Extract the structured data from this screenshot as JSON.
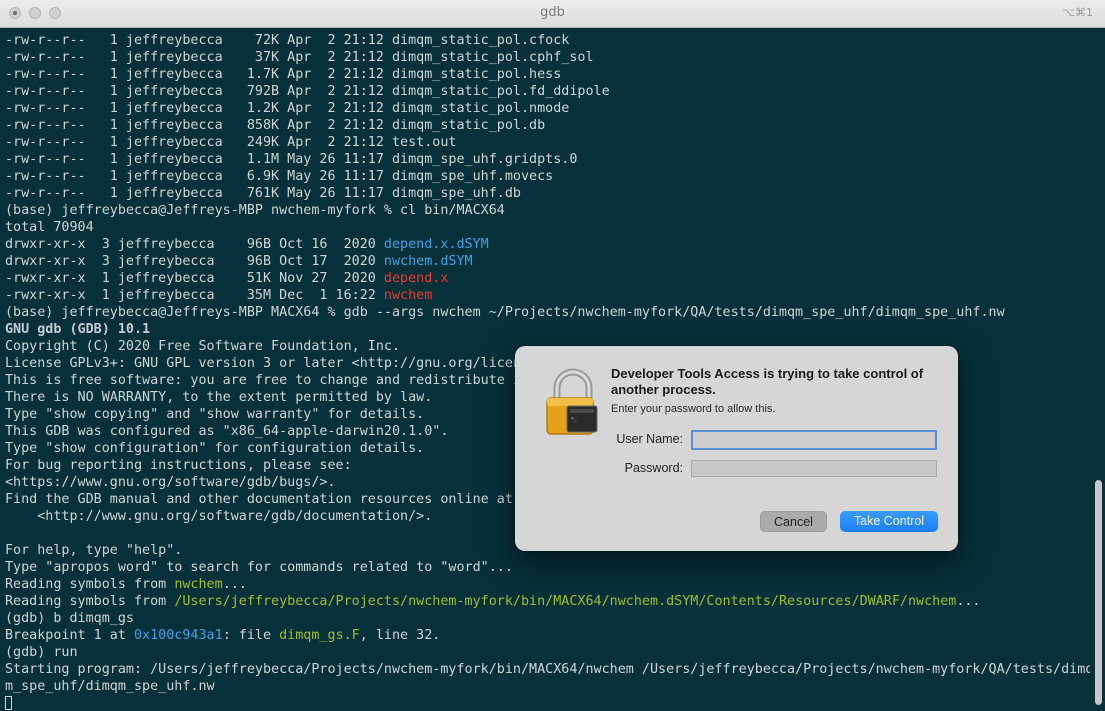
{
  "window": {
    "title": "gdb",
    "shortcut": "⌥⌘1"
  },
  "terminal": {
    "lines": [
      [
        {
          "t": "-rw-r--r--   1 jeffreybecca    72K Apr  2 21:12 dimqm_static_pol.cfock"
        }
      ],
      [
        {
          "t": "-rw-r--r--   1 jeffreybecca    37K Apr  2 21:12 dimqm_static_pol.cphf_sol"
        }
      ],
      [
        {
          "t": "-rw-r--r--   1 jeffreybecca   1.7K Apr  2 21:12 dimqm_static_pol.hess"
        }
      ],
      [
        {
          "t": "-rw-r--r--   1 jeffreybecca   792B Apr  2 21:12 dimqm_static_pol.fd_ddipole"
        }
      ],
      [
        {
          "t": "-rw-r--r--   1 jeffreybecca   1.2K Apr  2 21:12 dimqm_static_pol.nmode"
        }
      ],
      [
        {
          "t": "-rw-r--r--   1 jeffreybecca   858K Apr  2 21:12 dimqm_static_pol.db"
        }
      ],
      [
        {
          "t": "-rw-r--r--   1 jeffreybecca   249K Apr  2 21:12 test.out"
        }
      ],
      [
        {
          "t": "-rw-r--r--   1 jeffreybecca   1.1M May 26 11:17 dimqm_spe_uhf.gridpts.0"
        }
      ],
      [
        {
          "t": "-rw-r--r--   1 jeffreybecca   6.9K May 26 11:17 dimqm_spe_uhf.movecs"
        }
      ],
      [
        {
          "t": "-rw-r--r--   1 jeffreybecca   761K May 26 11:17 dimqm_spe_uhf.db"
        }
      ],
      [
        {
          "t": "(base) jeffreybecca@Jeffreys-MBP nwchem-myfork % cl bin/MACX64"
        }
      ],
      [
        {
          "t": "total 70904"
        }
      ],
      [
        {
          "t": "drwxr-xr-x  3 jeffreybecca    96B Oct 16  2020 "
        },
        {
          "t": "depend.x.dSYM",
          "c": "blue"
        }
      ],
      [
        {
          "t": "drwxr-xr-x  3 jeffreybecca    96B Oct 17  2020 "
        },
        {
          "t": "nwchem.dSYM",
          "c": "blue"
        }
      ],
      [
        {
          "t": "-rwxr-xr-x  1 jeffreybecca    51K Nov 27  2020 "
        },
        {
          "t": "depend.x",
          "c": "red"
        }
      ],
      [
        {
          "t": "-rwxr-xr-x  1 jeffreybecca    35M Dec  1 16:22 "
        },
        {
          "t": "nwchem",
          "c": "red"
        }
      ],
      [
        {
          "t": "(base) jeffreybecca@Jeffreys-MBP MACX64 % gdb --args nwchem ~/Projects/nwchem-myfork/QA/tests/dimqm_spe_uhf/dimqm_spe_uhf.nw"
        }
      ],
      [
        {
          "t": "GNU gdb (GDB) 10.1",
          "c": "bold"
        }
      ],
      [
        {
          "t": "Copyright (C) 2020 Free Software Foundation, Inc."
        }
      ],
      [
        {
          "t": "License GPLv3+: GNU GPL version 3 or later <http://gnu.org/licen"
        }
      ],
      [
        {
          "t": "This is free software: you are free to change and redistribute i"
        }
      ],
      [
        {
          "t": "There is NO WARRANTY, to the extent permitted by law."
        }
      ],
      [
        {
          "t": "Type \"show copying\" and \"show warranty\" for details."
        }
      ],
      [
        {
          "t": "This GDB was configured as \"x86_64-apple-darwin20.1.0\"."
        }
      ],
      [
        {
          "t": "Type \"show configuration\" for configuration details."
        }
      ],
      [
        {
          "t": "For bug reporting instructions, please see:"
        }
      ],
      [
        {
          "t": "<https://www.gnu.org/software/gdb/bugs/>."
        }
      ],
      [
        {
          "t": "Find the GDB manual and other documentation resources online at:"
        }
      ],
      [
        {
          "t": "    <http://www.gnu.org/software/gdb/documentation/>."
        }
      ],
      [
        {
          "t": ""
        }
      ],
      [
        {
          "t": "For help, type \"help\"."
        }
      ],
      [
        {
          "t": "Type \"apropos word\" to search for commands related to \"word\"..."
        }
      ],
      [
        {
          "t": "Reading symbols from "
        },
        {
          "t": "nwchem",
          "c": "green"
        },
        {
          "t": "..."
        }
      ],
      [
        {
          "t": "Reading symbols from "
        },
        {
          "t": "/Users/jeffreybecca/Projects/nwchem-myfork/bin/MACX64/nwchem.dSYM/Contents/Resources/DWARF/nwchem",
          "c": "green"
        },
        {
          "t": "..."
        }
      ],
      [
        {
          "t": "(gdb) b dimqm_gs"
        }
      ],
      [
        {
          "t": "Breakpoint 1 at "
        },
        {
          "t": "0x100c943a1",
          "c": "blue"
        },
        {
          "t": ": file "
        },
        {
          "t": "dimqm_gs.F",
          "c": "green"
        },
        {
          "t": ", line 32."
        }
      ],
      [
        {
          "t": "(gdb) run"
        }
      ],
      [
        {
          "t": "Starting program: /Users/jeffreybecca/Projects/nwchem-myfork/bin/MACX64/nwchem /Users/jeffreybecca/Projects/nwchem-myfork/QA/tests/dimq"
        }
      ],
      [
        {
          "t": "m_spe_uhf/dimqm_spe_uhf.nw"
        }
      ]
    ]
  },
  "dialog": {
    "title": "Developer Tools Access is trying to take control of another process.",
    "subtitle": "Enter your password to allow this.",
    "username_label": "User Name:",
    "username_value": "",
    "password_label": "Password:",
    "password_value": "",
    "cancel_label": "Cancel",
    "take_control_label": "Take Control"
  }
}
